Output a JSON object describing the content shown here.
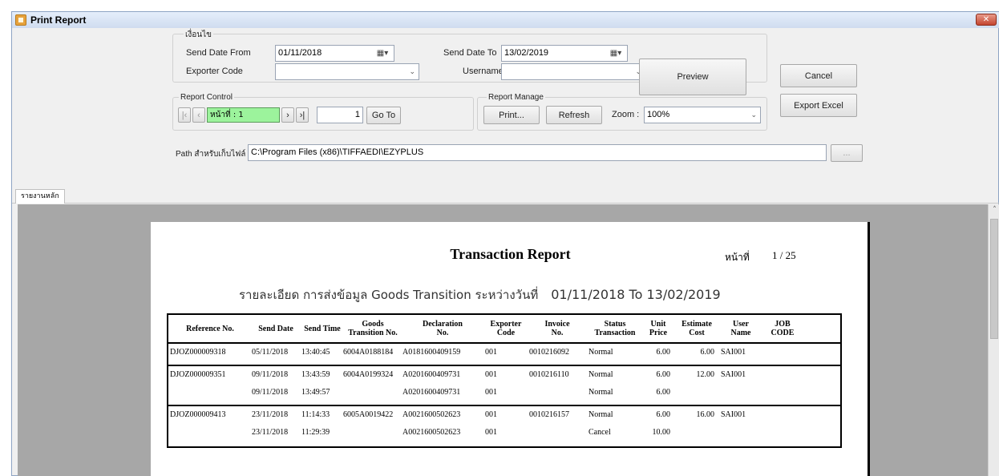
{
  "window": {
    "title": "Print Report",
    "close_glyph": "✕"
  },
  "filter": {
    "group_label": "เงื่อนไข",
    "send_date_from_label": "Send Date From",
    "send_date_from_value": "01/11/2018",
    "send_date_to_label": "Send Date To",
    "send_date_to_value": "13/02/2019",
    "exporter_code_label": "Exporter Code",
    "exporter_code_value": "",
    "username_label": "Username",
    "username_value": "",
    "calendar_glyph": "▦▾",
    "dropdown_glyph": "⌄"
  },
  "buttons": {
    "preview": "Preview",
    "cancel": "Cancel",
    "export_excel": "Export Excel",
    "go_to": "Go To",
    "print": "Print...",
    "refresh": "Refresh",
    "browse": "..."
  },
  "report_control": {
    "label": "Report Control",
    "first_glyph": "|‹",
    "prev_glyph": "‹",
    "page_display": "หน้าที่ : 1",
    "next_glyph": "›",
    "last_glyph": "›|",
    "goto_page_value": "1"
  },
  "report_manage": {
    "label": "Report Manage",
    "zoom_label": "Zoom :",
    "zoom_value": "100%"
  },
  "path": {
    "label": "Path สำหรับเก็บไฟล์",
    "value": "C:\\Program Files (x86)\\TIFFAEDI\\EZYPLUS"
  },
  "tabs": [
    {
      "label": "รายงานหลัก"
    }
  ],
  "scroll_up_glyph": "˄",
  "report": {
    "title": "Transaction Report",
    "page_label": "หน้าที่",
    "page_value": "1 / 25",
    "subtitle": "รายละเอียด การส่งข้อมูล Goods Transition ระหว่างวันที่",
    "date_range": "01/11/2018 To 13/02/2019",
    "columns": [
      {
        "line1": "Reference No.",
        "line2": ""
      },
      {
        "line1": "Send Date",
        "line2": ""
      },
      {
        "line1": "Send Time",
        "line2": ""
      },
      {
        "line1": "Goods",
        "line2": "Transition No."
      },
      {
        "line1": "Declaration",
        "line2": "No."
      },
      {
        "line1": "Exporter",
        "line2": "Code"
      },
      {
        "line1": "Invoice",
        "line2": "No."
      },
      {
        "line1": "Status",
        "line2": "Transaction"
      },
      {
        "line1": "Unit",
        "line2": "Price"
      },
      {
        "line1": "Estimate",
        "line2": "Cost"
      },
      {
        "line1": "User",
        "line2": "Name"
      },
      {
        "line1": "JOB",
        "line2": "CODE"
      }
    ],
    "groups": [
      {
        "rows": [
          [
            "DJOZ000009318",
            "05/11/2018",
            "13:40:45",
            "6004A0188184",
            "A0181600409159",
            "001",
            "0010216092",
            "Normal",
            "6.00",
            "6.00",
            "SAI001",
            ""
          ]
        ]
      },
      {
        "rows": [
          [
            "DJOZ000009351",
            "09/11/2018",
            "13:43:59",
            "6004A0199324",
            "A0201600409731",
            "001",
            "0010216110",
            "Normal",
            "6.00",
            "12.00",
            "SAI001",
            ""
          ],
          [
            "",
            "09/11/2018",
            "13:49:57",
            "",
            "A0201600409731",
            "001",
            "",
            "Normal",
            "6.00",
            "",
            "",
            ""
          ]
        ]
      },
      {
        "rows": [
          [
            "DJOZ000009413",
            "23/11/2018",
            "11:14:33",
            "6005A0019422",
            "A0021600502623",
            "001",
            "0010216157",
            "Normal",
            "6.00",
            "16.00",
            "SAI001",
            ""
          ],
          [
            "",
            "23/11/2018",
            "11:29:39",
            "",
            "A0021600502623",
            "001",
            "",
            "Cancel",
            "10.00",
            "",
            "",
            ""
          ]
        ]
      }
    ]
  }
}
